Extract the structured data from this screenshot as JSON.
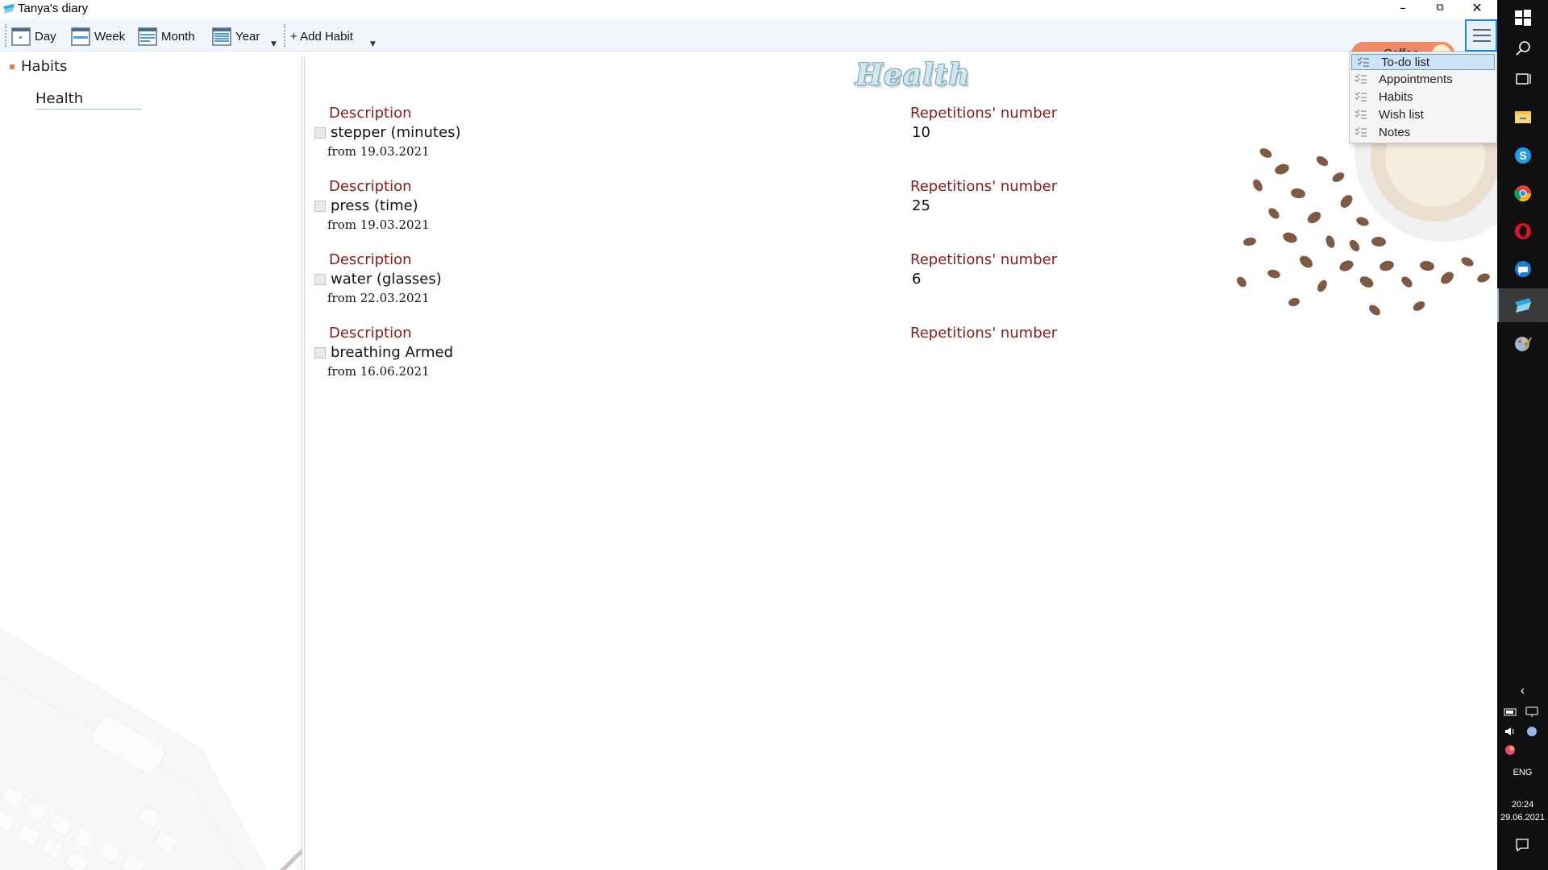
{
  "window": {
    "title": "Tanya's diary"
  },
  "toolbar": {
    "day_label": "Day",
    "week_label": "Week",
    "month_label": "Month",
    "year_label": "Year",
    "add_habit_label": "+ Add Habit",
    "theme_label": "Coffee"
  },
  "menu": {
    "items": [
      {
        "label": "To-do list",
        "selected": true
      },
      {
        "label": "Appointments"
      },
      {
        "label": "Habits"
      },
      {
        "label": "Wish list"
      },
      {
        "label": "Notes"
      }
    ]
  },
  "tree": {
    "root": "Habits",
    "child": "Health"
  },
  "main": {
    "title": "Health",
    "habits": [
      {
        "desc_label": "Description",
        "rep_label": "Repetitions' number",
        "name": "stepper (minutes)",
        "reps": "10",
        "date": "from 19.03.2021"
      },
      {
        "desc_label": "Description",
        "rep_label": "Repetitions' number",
        "name": "press (time)",
        "reps": "25",
        "date": "from 19.03.2021"
      },
      {
        "desc_label": "Description",
        "rep_label": "Repetitions' number",
        "name": "water (glasses)",
        "reps": "6",
        "date": "from 22.03.2021"
      },
      {
        "desc_label": "Description",
        "rep_label": "Repetitions' number",
        "name": "breathing Armed",
        "reps": "",
        "date": "from 16.06.2021"
      }
    ]
  },
  "taskbar": {
    "lang": "ENG",
    "time": "20:24",
    "date": "29.06.2021"
  },
  "colors": {
    "accent": "#1e88e5",
    "label_red": "#8b1b1b",
    "toggle": "#ee8b66",
    "taskbar": "#101010"
  }
}
